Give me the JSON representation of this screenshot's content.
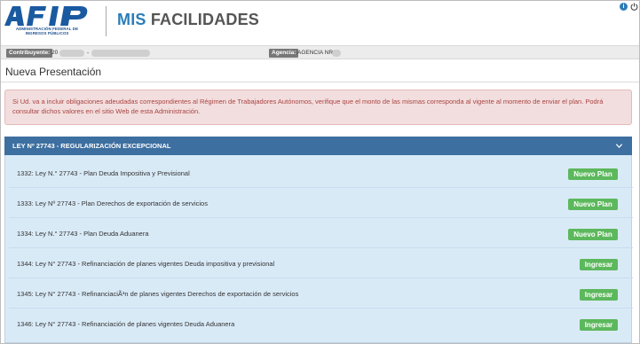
{
  "header": {
    "logo_letters": "AFIP",
    "logo_subtitle": "ADMINISTRACIÓN FEDERAL DE INGRESOS PÚBLICOS",
    "title_part1": "MIS",
    "title_part2": "FACILIDADES",
    "info_icon": "i"
  },
  "taxbar": {
    "contribuyente_label": "Contribuyente:",
    "contribuyente_value": "20",
    "separator": "-",
    "agencia_label": "Agencia:",
    "agencia_value": "AGENCIA NRO"
  },
  "page_title": "Nueva Presentación",
  "alert": {
    "text": "Si Ud. va a incluir obligaciones adeudadas correspondientes al Régimen de Trabajadores Autónomos, verifique que el monto de las mismas corresponda al vigente al momento de enviar el plan. Podrá consultar dichos valores en el sitio Web de esta Administración."
  },
  "accordion": {
    "title": "LEY Nº 27743 - REGULARIZACIÓN EXCEPCIONAL",
    "rows": [
      {
        "label": "1332: Ley N.° 27743 - Plan Deuda Impositiva y Previsional",
        "button": "Nuevo Plan"
      },
      {
        "label": "1333: Ley Nº 27743 - Plan Derechos de exportación de servicios",
        "button": "Nuevo Plan"
      },
      {
        "label": "1334: Ley N.° 27743 - Plan Deuda Aduanera",
        "button": "Nuevo Plan"
      },
      {
        "label": "1344: Ley N° 27743 - Refinanciación de planes vigentes Deuda impositiva y previsional",
        "button": "Ingresar"
      },
      {
        "label": "1345: Ley N° 27743 - RefinanciaciÃ³n de planes vigentes Derechos de exportación de servicios",
        "button": "Ingresar"
      },
      {
        "label": "1346: Ley N° 27743 - Refinanciación de planes vigentes Deuda Aduanera",
        "button": "Ingresar"
      }
    ]
  },
  "colors": {
    "brand_blue": "#2a7db8",
    "accordion_header": "#3d6fa0",
    "accordion_body": "#d9eaf7",
    "button_green": "#5cb85c",
    "alert_bg": "#f2dede",
    "alert_text": "#a94442"
  },
  "icons": {
    "info": "info-icon",
    "power": "power-icon",
    "chevron": "chevron-down-icon"
  }
}
